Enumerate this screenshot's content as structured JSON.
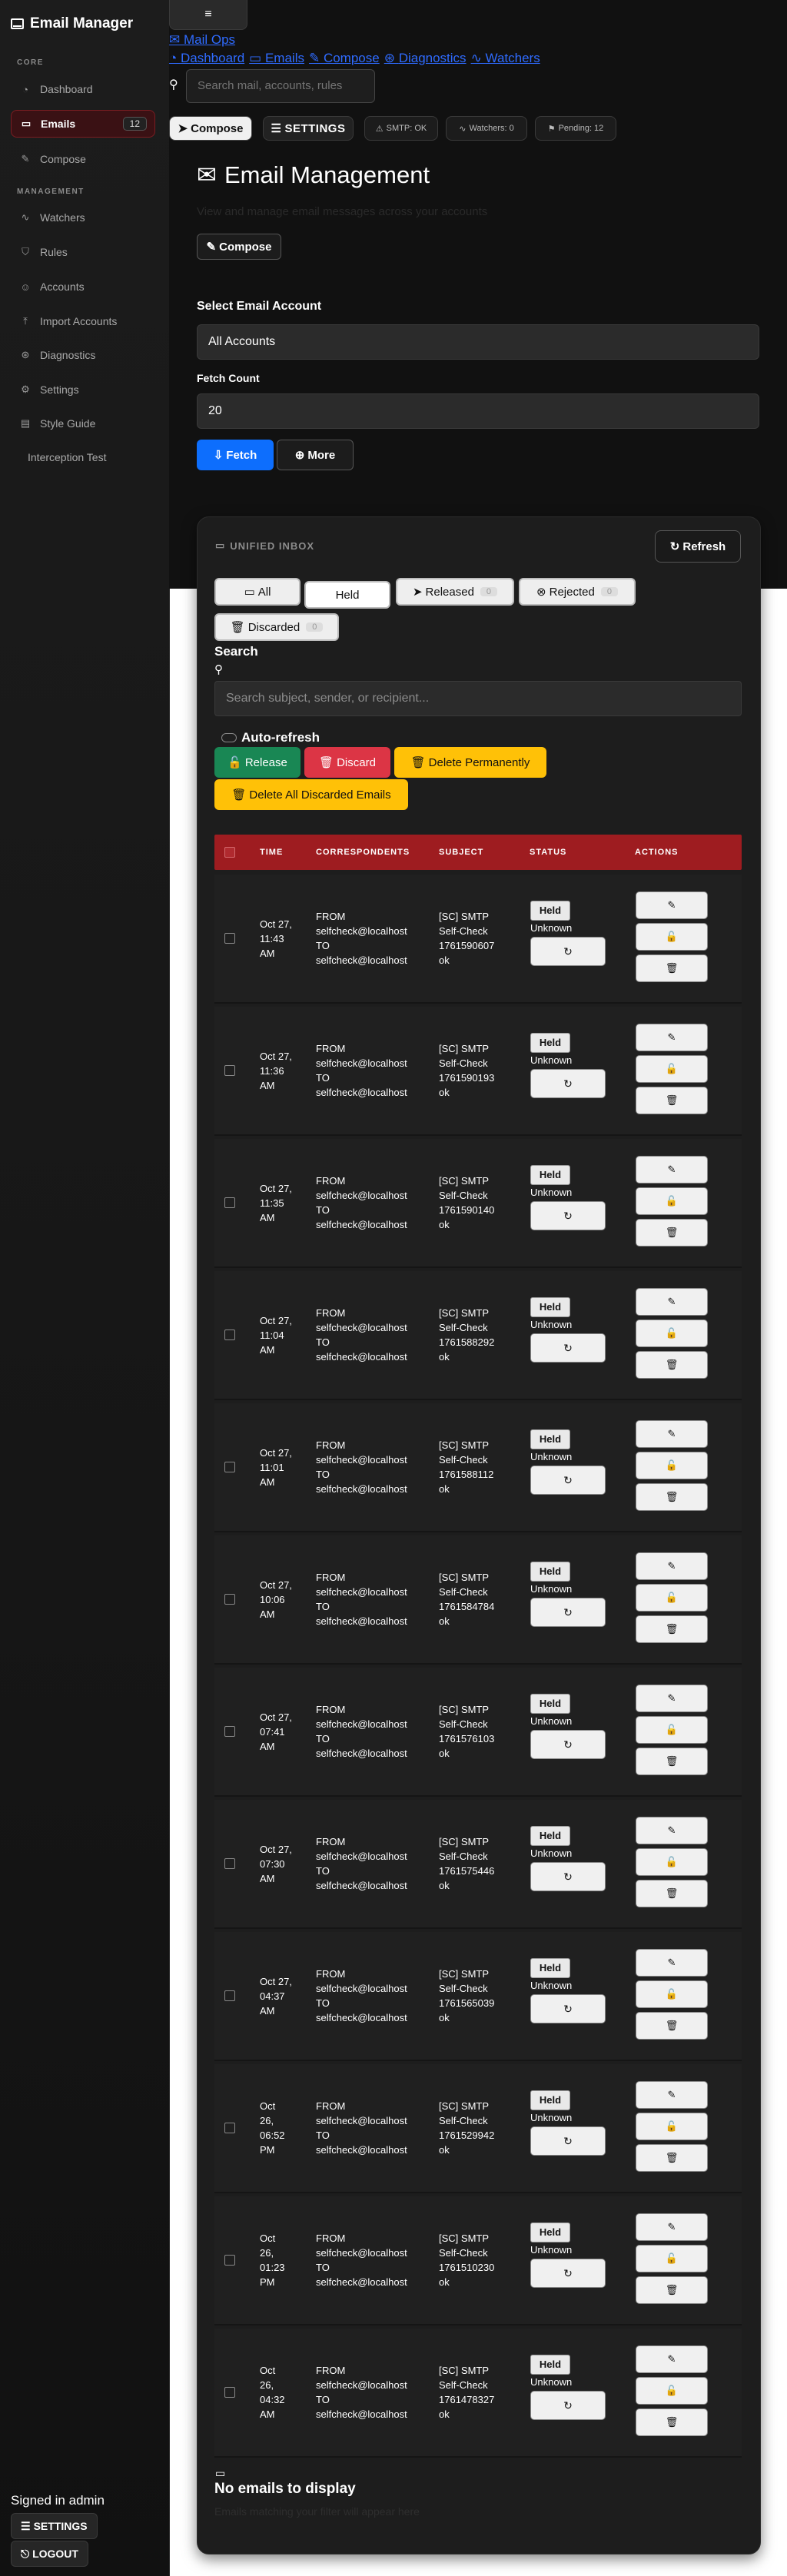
{
  "app": {
    "title": "Email Manager"
  },
  "sidebar": {
    "sections": [
      {
        "title": "CORE"
      },
      {
        "title": "MANAGEMENT"
      }
    ],
    "items": [
      {
        "label": "Dashboard",
        "icon": "dashboard-icon"
      },
      {
        "label": "Emails",
        "icon": "inbox-icon",
        "badge": "12"
      },
      {
        "label": "Compose",
        "icon": "edit-icon"
      },
      {
        "label": "Watchers",
        "icon": "activity-icon"
      },
      {
        "label": "Rules",
        "icon": "shield-icon"
      },
      {
        "label": "Accounts",
        "icon": "users-icon"
      },
      {
        "label": "Import Accounts",
        "icon": "upload-icon"
      },
      {
        "label": "Diagnostics",
        "icon": "diagnostics-icon"
      },
      {
        "label": "Settings",
        "icon": "gear-icon"
      },
      {
        "label": "Style Guide",
        "icon": "book-icon"
      },
      {
        "label": "Interception Test",
        "icon": ""
      }
    ],
    "signed_in": "Signed in admin",
    "settings_label": "SETTINGS",
    "logout_label": "LOGOUT"
  },
  "topbar": {
    "menu_glyph": "≡",
    "mail_ops": "Mail Ops",
    "links": [
      {
        "label": "Dashboard"
      },
      {
        "label": "Emails"
      },
      {
        "label": "Compose"
      },
      {
        "label": "Diagnostics"
      },
      {
        "label": "Watchers"
      }
    ],
    "search_placeholder": "Search mail, accounts, rules",
    "compose_label": "Compose",
    "settings_label": "SETTINGS",
    "status": {
      "smtp": "SMTP: OK",
      "watchers": "Watchers: 0",
      "pending": "Pending: 12"
    }
  },
  "page": {
    "title": "Email Management",
    "subtitle": "View and manage email messages across your accounts",
    "compose_label": "Compose",
    "account_label": "Select Email Account",
    "account_value": "All Accounts",
    "fetch_count_label": "Fetch Count",
    "fetch_count_value": "20",
    "fetch_label": "Fetch",
    "more_label": "More"
  },
  "inbox": {
    "title": "UNIFIED INBOX",
    "refresh_label": "Refresh",
    "tabs": [
      {
        "label": "All",
        "count": ""
      },
      {
        "label": "Held",
        "count": ""
      },
      {
        "label": "Released",
        "count": "0"
      },
      {
        "label": "Rejected",
        "count": "0"
      },
      {
        "label": "Discarded",
        "count": "0"
      }
    ],
    "search_label": "Search",
    "search_placeholder": "Search subject, sender, or recipient...",
    "auto_refresh_label": "Auto-refresh",
    "actions": {
      "release": "Release",
      "discard": "Discard",
      "delete_perm": "Delete Permanently",
      "delete_all": "Delete All Discarded Emails"
    },
    "columns": [
      "TIME",
      "CORRESPONDENTS",
      "SUBJECT",
      "STATUS",
      "ACTIONS"
    ],
    "rows": [
      {
        "time": [
          "Oct 27,",
          "11:43",
          "AM"
        ],
        "subject": [
          "[SC] SMTP",
          "Self-Check",
          "1761590607",
          "ok"
        ]
      },
      {
        "time": [
          "Oct 27,",
          "11:36",
          "AM"
        ],
        "subject": [
          "[SC] SMTP",
          "Self-Check",
          "1761590193",
          "ok"
        ]
      },
      {
        "time": [
          "Oct 27,",
          "11:35",
          "AM"
        ],
        "subject": [
          "[SC] SMTP",
          "Self-Check",
          "1761590140",
          "ok"
        ]
      },
      {
        "time": [
          "Oct 27,",
          "11:04",
          "AM"
        ],
        "subject": [
          "[SC] SMTP",
          "Self-Check",
          "1761588292",
          "ok"
        ]
      },
      {
        "time": [
          "Oct 27,",
          "11:01",
          "AM"
        ],
        "subject": [
          "[SC] SMTP",
          "Self-Check",
          "1761588112",
          "ok"
        ]
      },
      {
        "time": [
          "Oct 27,",
          "10:06",
          "AM"
        ],
        "subject": [
          "[SC] SMTP",
          "Self-Check",
          "1761584784",
          "ok"
        ]
      },
      {
        "time": [
          "Oct 27,",
          "07:41",
          "AM"
        ],
        "subject": [
          "[SC] SMTP",
          "Self-Check",
          "1761576103",
          "ok"
        ]
      },
      {
        "time": [
          "Oct 27,",
          "07:30",
          "AM"
        ],
        "subject": [
          "[SC] SMTP",
          "Self-Check",
          "1761575446",
          "ok"
        ]
      },
      {
        "time": [
          "Oct 27,",
          "04:37",
          "AM"
        ],
        "subject": [
          "[SC] SMTP",
          "Self-Check",
          "1761565039",
          "ok"
        ]
      },
      {
        "time": [
          "Oct",
          "26,",
          "06:52",
          "PM"
        ],
        "subject": [
          "[SC] SMTP",
          "Self-Check",
          "1761529942",
          "ok"
        ]
      },
      {
        "time": [
          "Oct",
          "26,",
          "01:23",
          "PM"
        ],
        "subject": [
          "[SC] SMTP",
          "Self-Check",
          "1761510230",
          "ok"
        ]
      },
      {
        "time": [
          "Oct",
          "26,",
          "04:32",
          "AM"
        ],
        "subject": [
          "[SC] SMTP",
          "Self-Check",
          "1761478327",
          "ok"
        ]
      }
    ],
    "row_common": {
      "from_label": "FROM",
      "from": "selfcheck@localhost",
      "to_label": "TO",
      "to": "selfcheck@localhost",
      "status": "Held",
      "substatus": "Unknown"
    },
    "empty_title": "No emails to display",
    "empty_sub": "Emails matching your filter will appear here"
  },
  "colors": {
    "accent": "#9e1c20",
    "primary": "#0d6efd",
    "release": "#198754",
    "discard": "#dc3545",
    "warning": "#ffc107"
  }
}
